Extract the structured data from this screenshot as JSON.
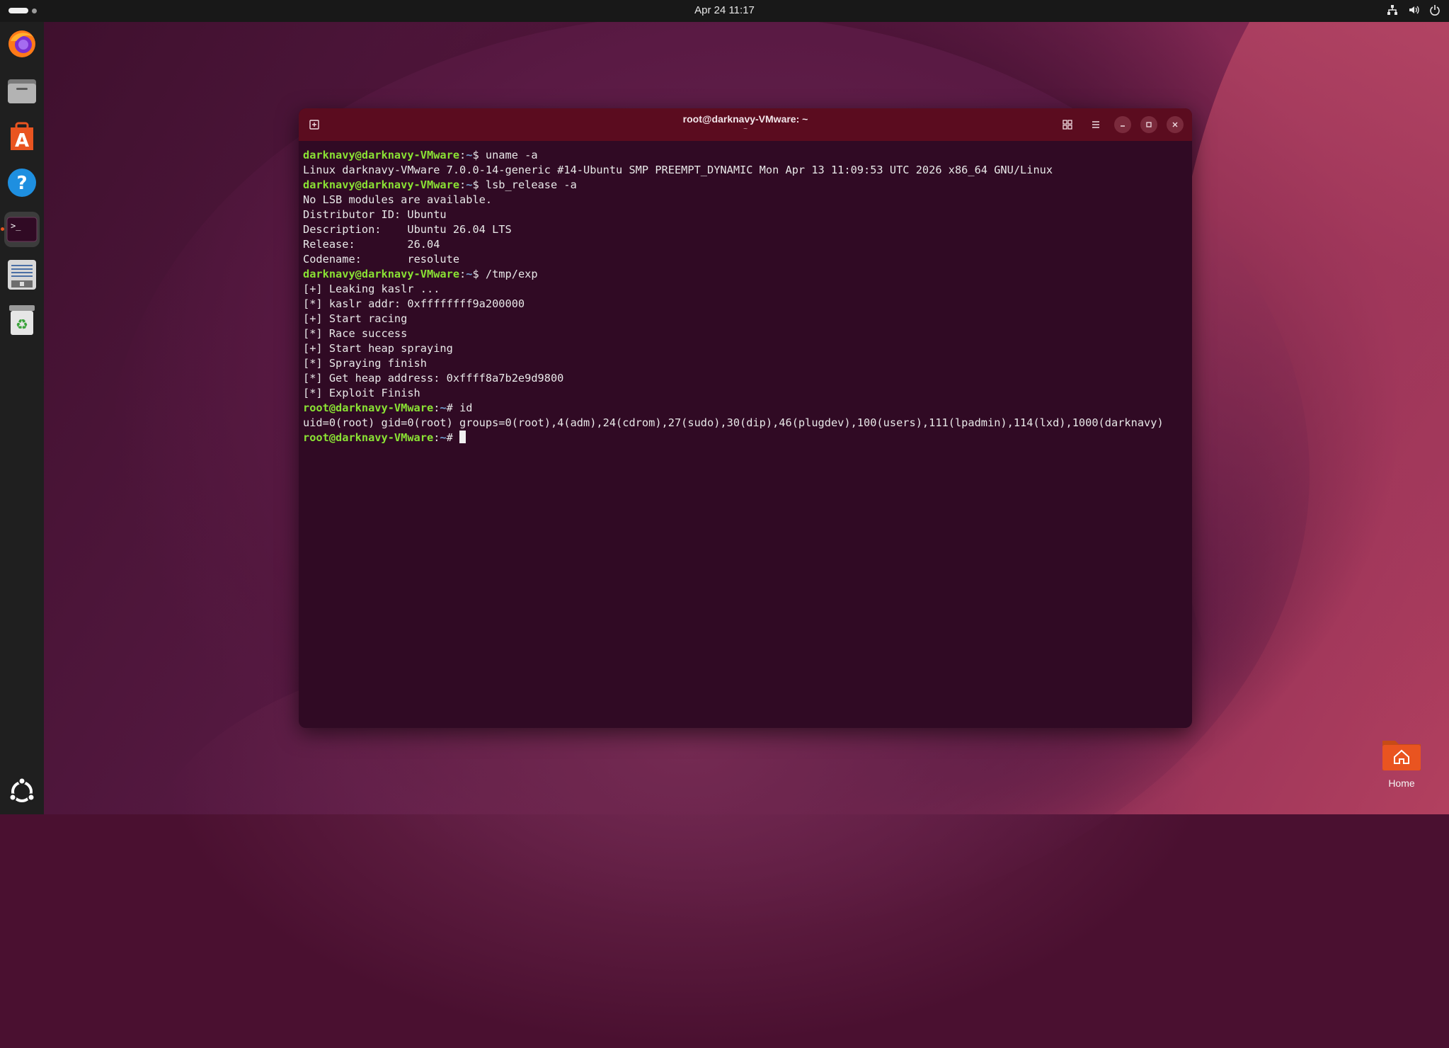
{
  "topbar": {
    "clock": "Apr 24  11:17",
    "tray_icons": [
      "network-icon",
      "volume-icon",
      "power-icon"
    ]
  },
  "dock": {
    "items": [
      {
        "name": "firefox-icon",
        "active": false
      },
      {
        "name": "files-icon",
        "active": false
      },
      {
        "name": "app-center-icon",
        "active": false
      },
      {
        "name": "help-icon",
        "active": false
      },
      {
        "name": "terminal-icon",
        "active": true
      },
      {
        "name": "text-editor-icon",
        "active": false
      },
      {
        "name": "trash-icon",
        "active": false
      }
    ],
    "show_apps": "ubuntu-logo-icon"
  },
  "terminal": {
    "title": "root@darknavy-VMware: ~",
    "subtitle": "~",
    "lines": [
      {
        "user": "darknavy@darknavy-VMware",
        "sep": ":",
        "path": "~",
        "sym": "$ ",
        "text": "uname -a"
      },
      {
        "text": "Linux darknavy-VMware 7.0.0-14-generic #14-Ubuntu SMP PREEMPT_DYNAMIC Mon Apr 13 11:09:53 UTC 2026 x86_64 GNU/Linux"
      },
      {
        "user": "darknavy@darknavy-VMware",
        "sep": ":",
        "path": "~",
        "sym": "$ ",
        "text": "lsb_release -a"
      },
      {
        "text": "No LSB modules are available."
      },
      {
        "text": "Distributor ID:\tUbuntu"
      },
      {
        "text": "Description:\tUbuntu 26.04 LTS"
      },
      {
        "text": "Release:\t26.04"
      },
      {
        "text": "Codename:\tresolute"
      },
      {
        "user": "darknavy@darknavy-VMware",
        "sep": ":",
        "path": "~",
        "sym": "$ ",
        "text": "/tmp/exp"
      },
      {
        "text": "[+] Leaking kaslr ..."
      },
      {
        "text": "[*] kaslr addr: 0xffffffff9a200000"
      },
      {
        "text": "[+] Start racing"
      },
      {
        "text": "[*] Race success"
      },
      {
        "text": "[+] Start heap spraying"
      },
      {
        "text": "[*] Spraying finish"
      },
      {
        "text": "[*] Get heap address: 0xffff8a7b2e9d9800"
      },
      {
        "text": "[*] Exploit Finish"
      },
      {
        "user": "root@darknavy-VMware",
        "sep": ":",
        "path": "~",
        "sym": "# ",
        "text": "id"
      },
      {
        "text": "uid=0(root) gid=0(root) groups=0(root),4(adm),24(cdrom),27(sudo),30(dip),46(plugdev),100(users),111(lpadmin),114(lxd),1000(darknavy)"
      },
      {
        "user": "root@darknavy-VMware",
        "sep": ":",
        "path": "~",
        "sym": "# ",
        "text": "",
        "cursor": true
      }
    ]
  },
  "desktop": {
    "home_label": "Home"
  },
  "colors": {
    "terminal_bg": "#300a24",
    "titlebar_bg": "#5b0c1f",
    "prompt_user": "#8ae234",
    "prompt_path": "#729fcf",
    "accent": "#e95420"
  }
}
